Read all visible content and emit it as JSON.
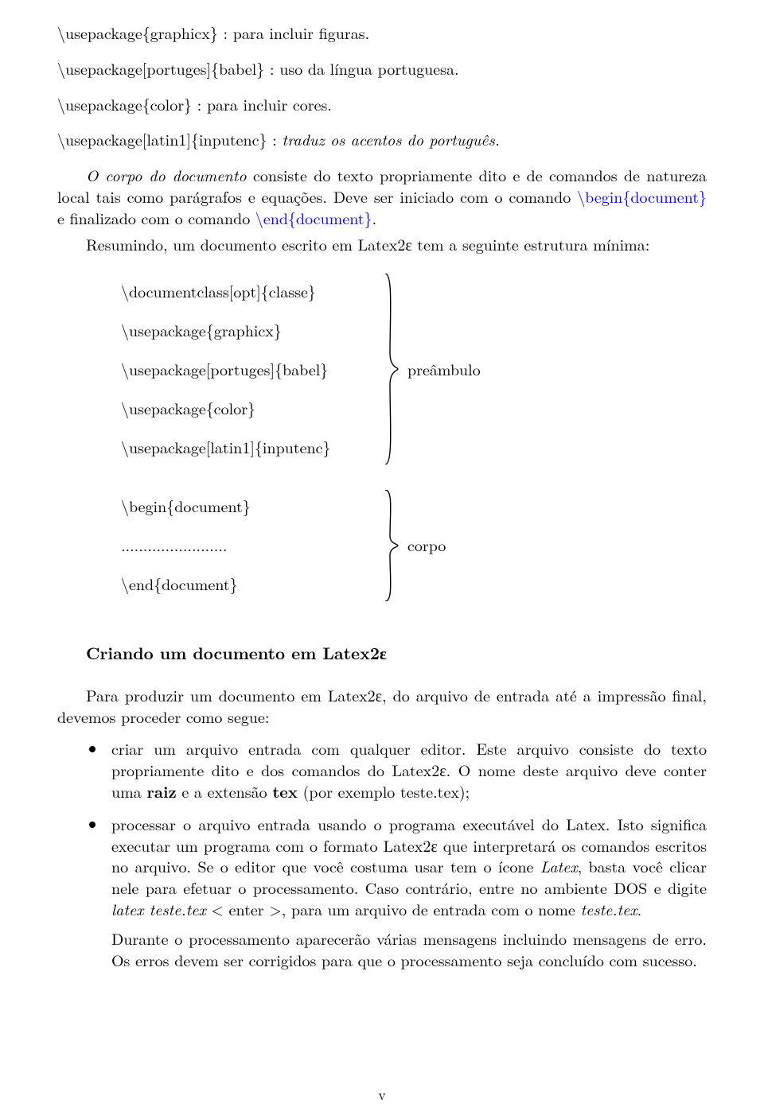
{
  "descriptions": [
    {
      "cmd": "\\usepackage{graphicx}",
      "sep": " : ",
      "text": "para incluir figuras."
    },
    {
      "cmd": "\\usepackage[portuges]{babel}",
      "sep": " : ",
      "text": "uso da língua portuguesa."
    },
    {
      "cmd": "\\usepackage{color}",
      "sep": " : ",
      "text": "para incluir cores."
    },
    {
      "cmd": "\\usepackage[latin1]{inputenc}",
      "sep": " : ",
      "text": "traduz os acentos do português.",
      "textItalic": true
    }
  ],
  "corpo_para": {
    "lead_italic": "O corpo do documento",
    "rest1": " consiste do texto propriamente dito e de comandos de natureza local tais como parágrafos e equações. Deve ser iniciado com o comando ",
    "blue1": "\\begin{document}",
    "rest2": " e finalizado com o comando ",
    "blue2": "\\end{document}",
    "rest3": "."
  },
  "resumo_line": "Resumindo, um documento escrito em Latex2ε tem a seguinte estrutura mínima:",
  "preamble_items": [
    "\\documentclass[opt]{classe}",
    "\\usepackage{graphicx}",
    "\\usepackage[portuges]{babel}",
    "\\usepackage{color}",
    "\\usepackage[latin1]{inputenc}"
  ],
  "preamble_label": "preâmbulo",
  "body_items": [
    "\\begin{document}",
    "........................",
    "\\end{document}"
  ],
  "body_label": "corpo",
  "section_heading": "Criando um documento em Latex2ε",
  "produce_para": "Para produzir um documento em Latex2ε, do arquivo de entrada até a impressão final, devemos proceder como segue:",
  "bullet1": {
    "t1": "criar um arquivo entrada com qualquer editor. Este arquivo consiste do texto propriamente dito e dos comandos do Latex2ε. O nome deste arquivo deve conter uma ",
    "b1": "raiz",
    "t2": " e a extensão ",
    "b2": "tex",
    "t3": " (por exemplo teste.tex);"
  },
  "bullet2": {
    "t1": "processar o arquivo entrada usando o programa executável do Latex. Isto significa executar um programa com o formato Latex2ε que interpretará os comandos escritos no arquivo. Se o editor que você costuma usar tem o ícone ",
    "i1": "Latex",
    "t2": ", basta você clicar nele para efetuar o processamento. Caso contrário, entre no ambiente DOS e digite ",
    "i2": "latex teste.tex",
    "t3": " < enter >, para um arquivo de entrada com o nome ",
    "i3": "teste.tex",
    "t4": ".",
    "sub": "Durante o processamento aparecerão várias mensagens incluindo mensagens de erro. Os erros devem ser corrigidos para que o processamento seja concluído com sucesso."
  },
  "page_number": "v"
}
